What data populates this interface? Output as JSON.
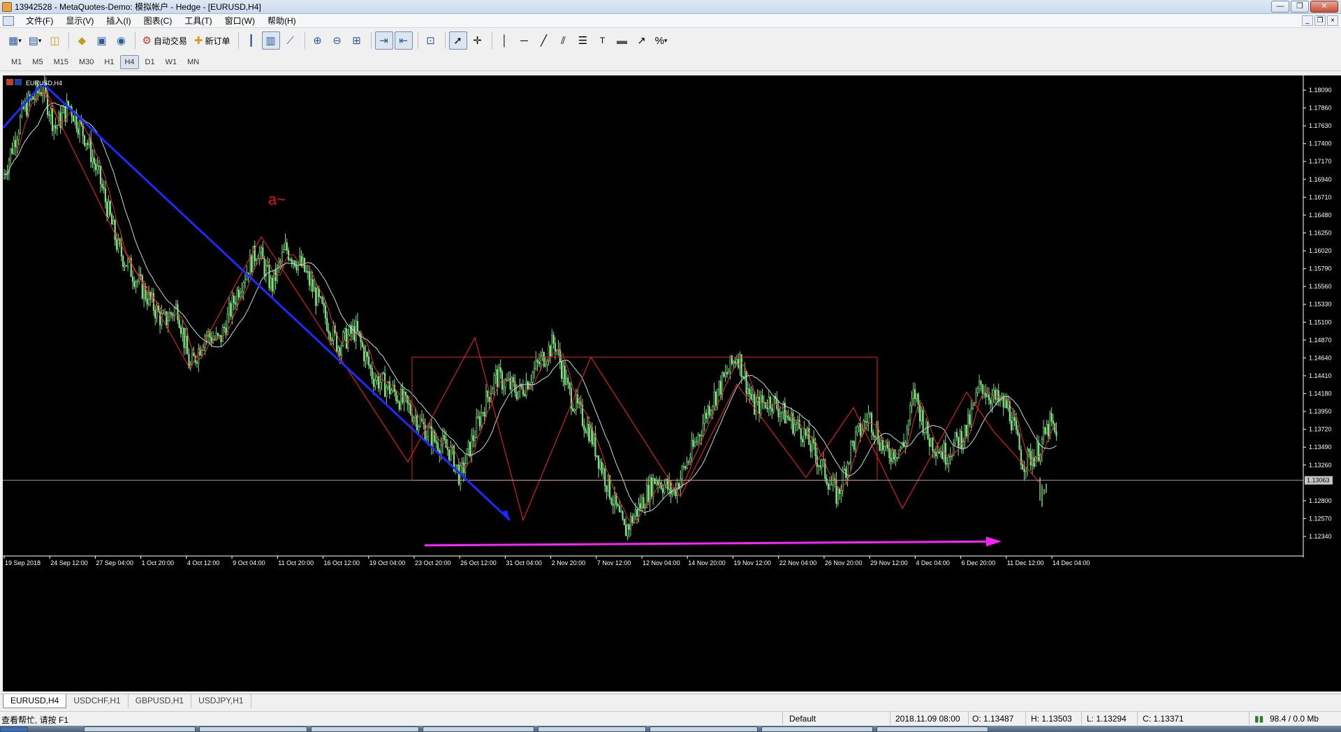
{
  "titlebar": {
    "title": "13942528 - MetaQuotes-Demo: 模拟帐户 - Hedge - [EURUSD,H4]",
    "minimize": "—",
    "restore": "❐",
    "close": "✕"
  },
  "menubar": {
    "items": [
      "文件(F)",
      "显示(V)",
      "插入(I)",
      "图表(C)",
      "工具(T)",
      "窗口(W)",
      "帮助(H)"
    ],
    "mdi_minimize": "_",
    "mdi_restore": "❐",
    "mdi_close": "×"
  },
  "toolbar": {
    "autotrade_label": "自动交易",
    "neworder_label": "新订单",
    "icons": {
      "new_chart": "new-chart-icon",
      "profiles": "profiles-icon",
      "market_watch": "market-watch-icon",
      "navigator": "navigator-icon",
      "terminal": "terminal-icon",
      "signals": "signals-icon",
      "bar_chart": "bar-chart-icon",
      "candle_chart": "candlestick-chart-icon",
      "line_chart": "line-chart-icon",
      "zoom_in": "zoom-in-icon",
      "zoom_out": "zoom-out-icon",
      "tile": "tile-windows-icon",
      "autoscroll": "autoscroll-icon",
      "chart_shift": "chart-shift-icon",
      "indicators": "indicators-icon",
      "cursor": "cursor-icon",
      "crosshair": "crosshair-icon",
      "vline": "vertical-line-icon",
      "hline": "horizontal-line-icon",
      "trendline": "trendline-icon",
      "equidistant": "equidistant-channel-icon",
      "fibo": "fibonacci-icon",
      "text": "text-icon",
      "label": "text-label-icon",
      "arrows": "arrows-icon",
      "periods": "periods-icon"
    }
  },
  "timeframes": [
    "M1",
    "M5",
    "M15",
    "M30",
    "H1",
    "H4",
    "D1",
    "W1",
    "MN"
  ],
  "active_timeframe": "H4",
  "chart": {
    "symbol_label": "EURUSD,H4",
    "annotation": "a~",
    "current_price_label": "1.13063",
    "price_ticks": [
      "1.18090",
      "1.17860",
      "1.17630",
      "1.17400",
      "1.17170",
      "1.16940",
      "1.16710",
      "1.16480",
      "1.16250",
      "1.16020",
      "1.15790",
      "1.15560",
      "1.15330",
      "1.15100",
      "1.14870",
      "1.14640",
      "1.14410",
      "1.14180",
      "1.13950",
      "1.13720",
      "1.13490",
      "1.13260",
      "1.13063",
      "1.12800",
      "1.12570",
      "1.12340"
    ],
    "time_ticks": [
      "19 Sep 2018",
      "24 Sep 12:00",
      "27 Sep 04:00",
      "1 Oct 20:00",
      "4 Oct 12:00",
      "9 Oct 04:00",
      "11 Oct 20:00",
      "16 Oct 12:00",
      "19 Oct 04:00",
      "23 Oct 20:00",
      "26 Oct 12:00",
      "31 Oct 04:00",
      "2 Nov 20:00",
      "7 Nov 12:00",
      "12 Nov 04:00",
      "14 Nov 20:00",
      "19 Nov 12:00",
      "22 Nov 04:00",
      "26 Nov 20:00",
      "29 Nov 12:00",
      "4 Dec 04:00",
      "6 Dec 20:00",
      "11 Dec 12:00",
      "14 Dec 04:00"
    ],
    "colors": {
      "background": "#000000",
      "bars": "#7fe07f",
      "ma_fast": "#e03030",
      "ma_slow": "#b8e0e0",
      "zigzag": "#ff2020",
      "trendline": "#1e28ff",
      "support_arrow": "#ff20ff",
      "range_box": "#e02020",
      "price_line": "#c8c8c8",
      "axis_text": "#ffffff"
    }
  },
  "tabs": [
    "EURUSD,H4",
    "USDCHF,H1",
    "GBPUSD,H1",
    "USDJPY,H1"
  ],
  "active_tab": "EURUSD,H4",
  "statusbar": {
    "help": "查看帮忙, 请按 F1",
    "profile": "Default",
    "datetime": "2018.11.09 08:00",
    "open": "O: 1.13487",
    "high": "H: 1.13503",
    "low": "L: 1.13294",
    "close": "C: 1.13371",
    "traffic": "98.4 / 0.0 Mb"
  }
}
